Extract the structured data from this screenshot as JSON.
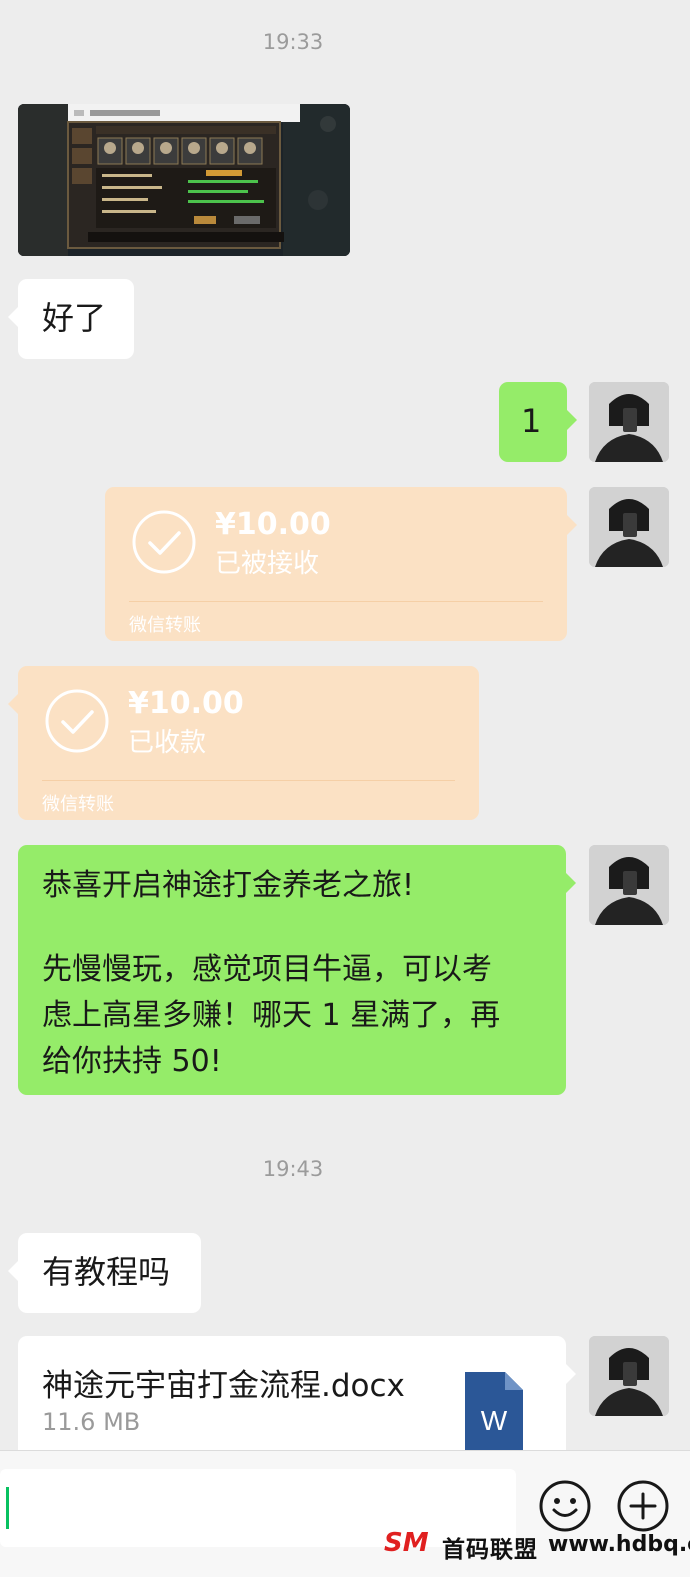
{
  "messages": {
    "time_1": "19:33",
    "reply_1": "好了",
    "sent_1": "1",
    "transfer_sent": {
      "amount": "¥10.00",
      "status": "已被接收",
      "footer": "微信转账"
    },
    "transfer_recv": {
      "amount": "¥10.00",
      "status": "已收款",
      "footer": "微信转账"
    },
    "long_msg": {
      "line1": "恭喜开启神途打金养老之旅!",
      "line2": "先慢慢玩，感觉项目牛逼，可以考",
      "line3": "虑上高星多赚！哪天 1 星满了，再",
      "line4": "给你扶持 50!"
    },
    "time_2": "19:43",
    "reply_2": "有教程吗",
    "file": {
      "name": "神途元宇宙打金流程.docx",
      "size": "11.6 MB",
      "icon_letter": "W"
    }
  },
  "watermark": {
    "logo": "SM",
    "cn": "首码联盟",
    "url": "www.hdbq.cc"
  },
  "icons": {
    "check": "check-circle-icon",
    "doc": "word-doc-icon",
    "emoji": "emoji-icon",
    "plus": "plus-icon"
  },
  "colors": {
    "green": "#95ec69",
    "transfer": "#fbe1c4",
    "word": "#2b5797",
    "caret": "#07c160"
  }
}
